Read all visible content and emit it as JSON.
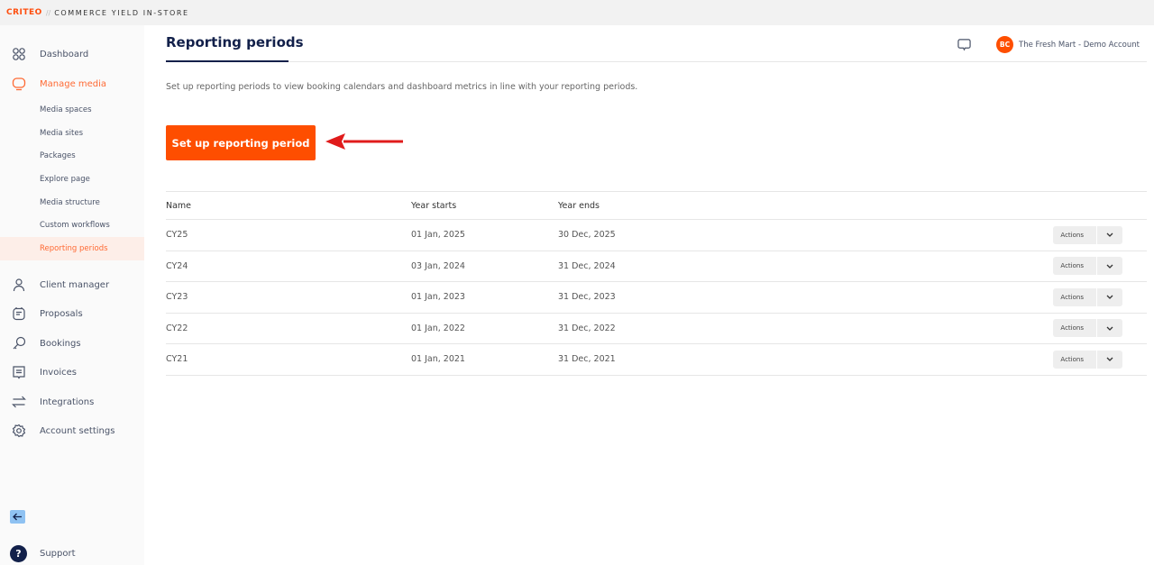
{
  "app": {
    "brand": "CRITEO",
    "product": "COMMERCE YIELD IN-STORE",
    "accent": "#fe4e00"
  },
  "sidebar": {
    "items": [
      {
        "label": "Dashboard",
        "icon": "grid-icon"
      },
      {
        "label": "Manage media",
        "icon": "monitor-icon",
        "active": true
      },
      {
        "label": "Client manager",
        "icon": "user-icon"
      },
      {
        "label": "Proposals",
        "icon": "clipboard-icon"
      },
      {
        "label": "Bookings",
        "icon": "key-icon"
      },
      {
        "label": "Invoices",
        "icon": "receipt-icon"
      },
      {
        "label": "Integrations",
        "icon": "arrows-exchange-icon"
      },
      {
        "label": "Account settings",
        "icon": "gear-icon"
      }
    ],
    "subitems": [
      "Media spaces",
      "Media sites",
      "Packages",
      "Explore page",
      "Media structure",
      "Custom workflows",
      "Reporting periods"
    ],
    "active_subitem": "Reporting periods",
    "support": "Support"
  },
  "header": {
    "title": "Reporting periods",
    "account_initials": "BC",
    "account_name": "The Fresh Mart - Demo Account"
  },
  "main": {
    "description": "Set up reporting periods to view booking calendars and dashboard metrics in line with your reporting periods.",
    "setup_button": "Set up reporting period",
    "table": {
      "columns": [
        "Name",
        "Year starts",
        "Year ends"
      ],
      "actions_label": "Actions",
      "rows": [
        [
          "CY25",
          "01 Jan, 2025",
          "30 Dec, 2025"
        ],
        [
          "CY24",
          "03 Jan, 2024",
          "31 Dec, 2024"
        ],
        [
          "CY23",
          "01 Jan, 2023",
          "31 Dec, 2023"
        ],
        [
          "CY22",
          "01 Jan, 2022",
          "31 Dec, 2022"
        ],
        [
          "CY21",
          "01 Jan, 2021",
          "31 Dec, 2021"
        ]
      ]
    }
  }
}
